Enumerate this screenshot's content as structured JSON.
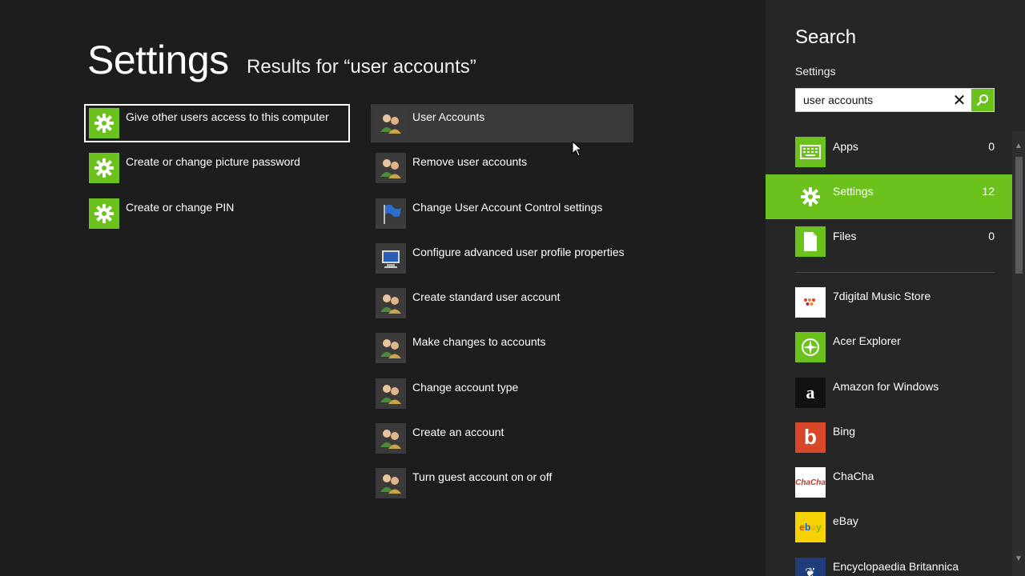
{
  "main": {
    "title": "Settings",
    "subtitle": "Results for “user accounts”",
    "left_results": [
      {
        "label": "Give other users access to this computer"
      },
      {
        "label": "Create or change picture password"
      },
      {
        "label": "Create or change PIN"
      }
    ],
    "right_results": [
      {
        "label": "User Accounts"
      },
      {
        "label": "Remove user accounts"
      },
      {
        "label": "Change User Account Control settings"
      },
      {
        "label": "Configure advanced user profile properties"
      },
      {
        "label": "Create standard user account"
      },
      {
        "label": "Make changes to accounts"
      },
      {
        "label": "Change account type"
      },
      {
        "label": "Create an account"
      },
      {
        "label": "Turn guest account on or off"
      }
    ]
  },
  "search": {
    "title": "Search",
    "scope": "Settings",
    "query": "user accounts",
    "categories": [
      {
        "label": "Apps",
        "count": "0",
        "icon": "keyboard-icon"
      },
      {
        "label": "Settings",
        "count": "12",
        "icon": "gear-icon"
      },
      {
        "label": "Files",
        "count": "0",
        "icon": "file-icon"
      }
    ],
    "apps": [
      {
        "label": "7digital Music Store",
        "icon": "7digital-icon",
        "color": "#ffffff"
      },
      {
        "label": "Acer Explorer",
        "icon": "acer-explorer-icon",
        "color": "#6cc21c"
      },
      {
        "label": "Amazon for Windows",
        "icon": "amazon-icon",
        "color": "#111111"
      },
      {
        "label": "Bing",
        "icon": "bing-icon",
        "color": "#d9472b"
      },
      {
        "label": "ChaCha",
        "icon": "chacha-icon",
        "color": "#ffffff"
      },
      {
        "label": "eBay",
        "icon": "ebay-icon",
        "color": "#f5d200"
      },
      {
        "label": "Encyclopaedia Britannica",
        "icon": "britannica-icon",
        "color": "#1f3d7a"
      }
    ]
  },
  "colors": {
    "accent": "#6cc21c",
    "background": "#1d1d1d",
    "pane": "#262626"
  }
}
